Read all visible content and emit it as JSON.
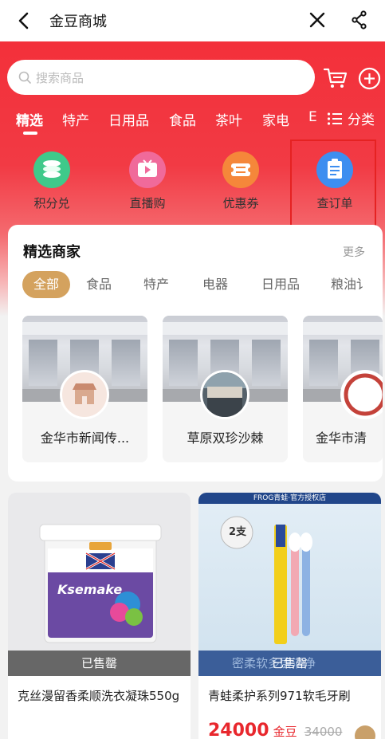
{
  "header": {
    "title": "金豆商城"
  },
  "search": {
    "placeholder": "搜索商品"
  },
  "categories": [
    "精选",
    "特产",
    "日用品",
    "食品",
    "茶叶",
    "家电",
    "E"
  ],
  "menu": {
    "label": "分类"
  },
  "quick_entries": [
    {
      "label": "积分兑",
      "icon": "points-stack-icon",
      "color": "#3fc98a"
    },
    {
      "label": "直播购",
      "icon": "live-tv-icon",
      "color": "#f06a9a"
    },
    {
      "label": "优惠券",
      "icon": "coupon-icon",
      "color": "#f5873a"
    },
    {
      "label": "查订单",
      "icon": "order-list-icon",
      "color": "#3d8ef0"
    }
  ],
  "merchants": {
    "title": "精选商家",
    "more": "更多",
    "filters": [
      "全部",
      "食品",
      "特产",
      "电器",
      "日用品",
      "粮油讠"
    ],
    "shops": [
      {
        "name": "金华市新闻传..."
      },
      {
        "name": "草原双珍沙棘"
      },
      {
        "name": "金华市清"
      }
    ]
  },
  "products": [
    {
      "name": "克丝漫留香柔顺洗衣凝珠550g",
      "status": "已售罄",
      "brand_text": "Ksemake"
    },
    {
      "name": "青蛙柔护系列971软毛牙刷",
      "status": "已售罄",
      "price": "24000",
      "price_unit": "金豆",
      "original_price": "34000",
      "banner": "FROG青蛙·官方授权店",
      "tag": "2支",
      "tagline": "密柔软多层洁净"
    }
  ],
  "colors": {
    "accent": "#f3303a",
    "gold": "#d4a25e",
    "price": "#e8272d"
  }
}
